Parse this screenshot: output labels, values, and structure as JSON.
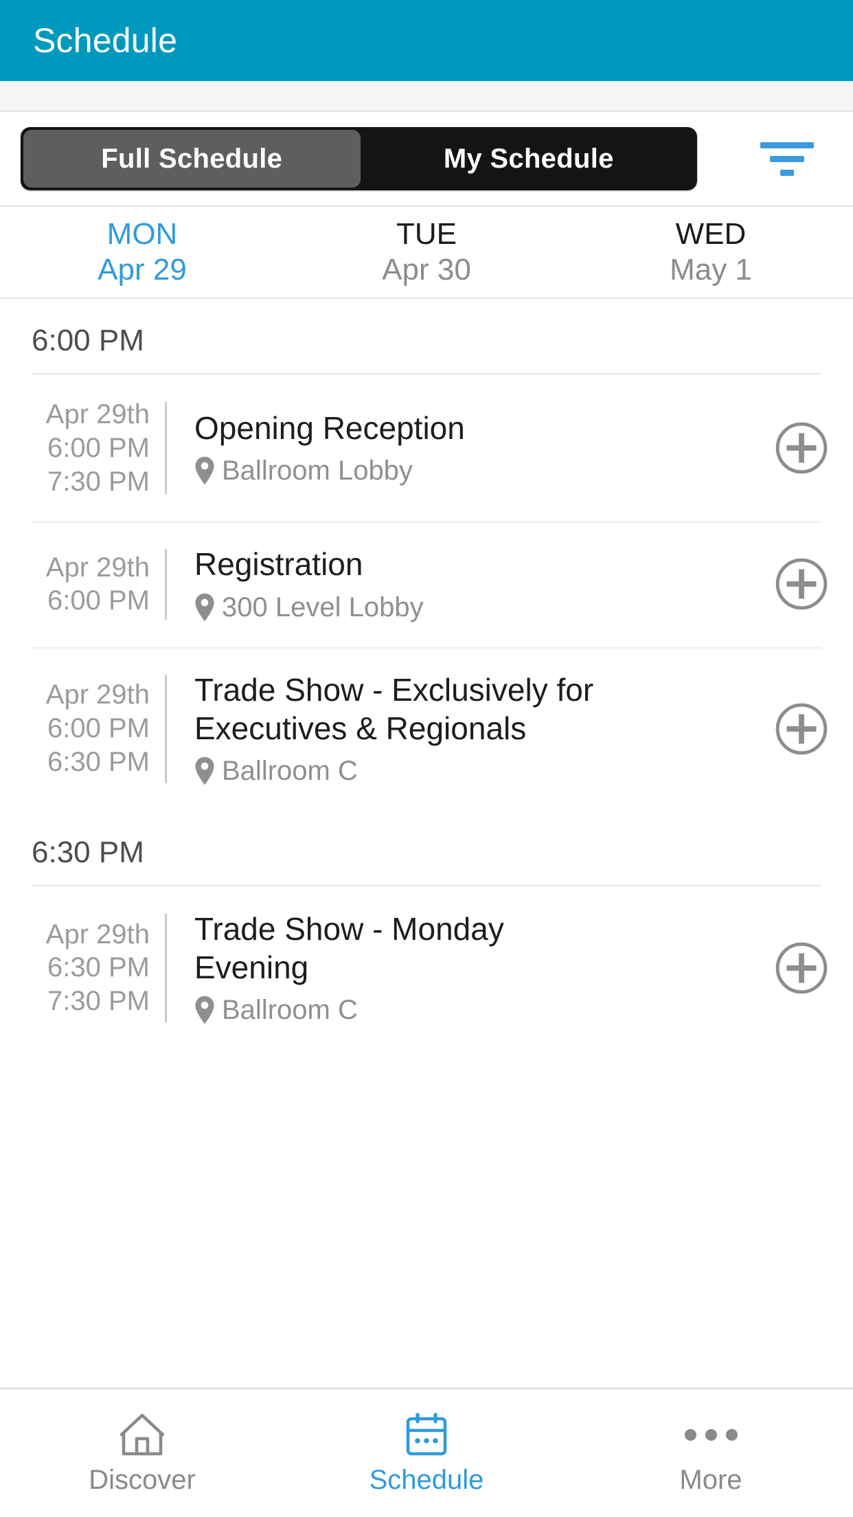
{
  "header": {
    "title": "Schedule",
    "background_color": "#0099be"
  },
  "accent_color": "#2f9bda",
  "segmented_control": {
    "options": [
      {
        "label": "Full Schedule",
        "active": true
      },
      {
        "label": "My Schedule",
        "active": false
      }
    ],
    "filter_icon": "filter-icon"
  },
  "day_tabs": [
    {
      "day": "MON",
      "date": "Apr 29",
      "active": true
    },
    {
      "day": "TUE",
      "date": "Apr 30",
      "active": false
    },
    {
      "day": "WED",
      "date": "May 1",
      "active": false
    }
  ],
  "schedule_groups": [
    {
      "time_label": "6:00 PM",
      "events": [
        {
          "date": "Apr 29th",
          "start_time": "6:00 PM",
          "end_time": "7:30 PM",
          "title": "Opening Reception",
          "location": "Ballroom Lobby",
          "action": "add"
        },
        {
          "date": "Apr 29th",
          "start_time": "6:00 PM",
          "end_time": "",
          "title": "Registration",
          "location": "300 Level Lobby",
          "action": "add"
        },
        {
          "date": "Apr 29th",
          "start_time": "6:00 PM",
          "end_time": "6:30 PM",
          "title": "Trade Show - Exclusively for Executives & Regionals",
          "location": "Ballroom C",
          "action": "add"
        }
      ]
    },
    {
      "time_label": "6:30 PM",
      "events": [
        {
          "date": "Apr 29th",
          "start_time": "6:30 PM",
          "end_time": "7:30 PM",
          "title": "Trade Show - Monday Evening",
          "location": "Ballroom C",
          "action": "add"
        }
      ]
    }
  ],
  "tabbar": [
    {
      "label": "Discover",
      "icon": "home-icon",
      "active": false
    },
    {
      "label": "Schedule",
      "icon": "calendar-icon",
      "active": true
    },
    {
      "label": "More",
      "icon": "ellipsis-icon",
      "active": false
    }
  ]
}
